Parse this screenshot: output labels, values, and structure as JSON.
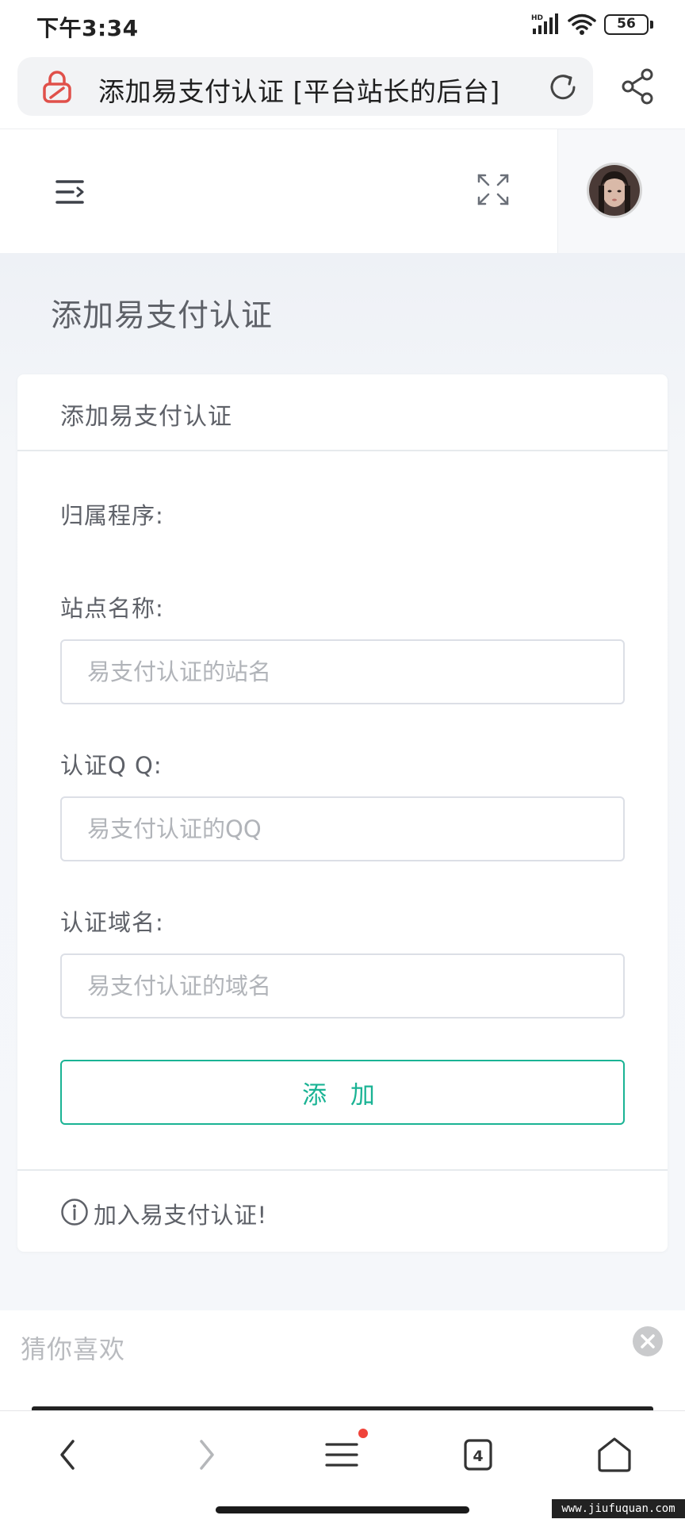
{
  "status_bar": {
    "time": "下午3:34",
    "network_label": "HD",
    "battery_level": "56"
  },
  "browser": {
    "page_title": "添加易支付认证 [平台站长的后台]",
    "lock_icon": "lock-icon",
    "reload_icon": "reload-icon",
    "share_icon": "share-icon"
  },
  "app_header": {
    "menu_icon": "menu-fold-icon",
    "fullscreen_icon": "expand-icon"
  },
  "page": {
    "title": "添加易支付认证"
  },
  "form": {
    "card_title": "添加易支付认证",
    "program_label": "归属程序:",
    "site_name_label": "站点名称:",
    "site_name_placeholder": "易支付认证的站名",
    "qq_label": "认证Q Q:",
    "qq_placeholder": "易支付认证的QQ",
    "domain_label": "认证域名:",
    "domain_placeholder": "易支付认证的域名",
    "submit_label": "添 加",
    "footer_note": "加入易支付认证!"
  },
  "recommend": {
    "label": "猜你喜欢"
  },
  "bottom_nav": {
    "tab_count": "4"
  },
  "watermark": {
    "text": "www.jiufuquan.com"
  },
  "colors": {
    "accent": "#1ab394",
    "lock": "#e0504a",
    "notification_dot": "#f0433a"
  }
}
